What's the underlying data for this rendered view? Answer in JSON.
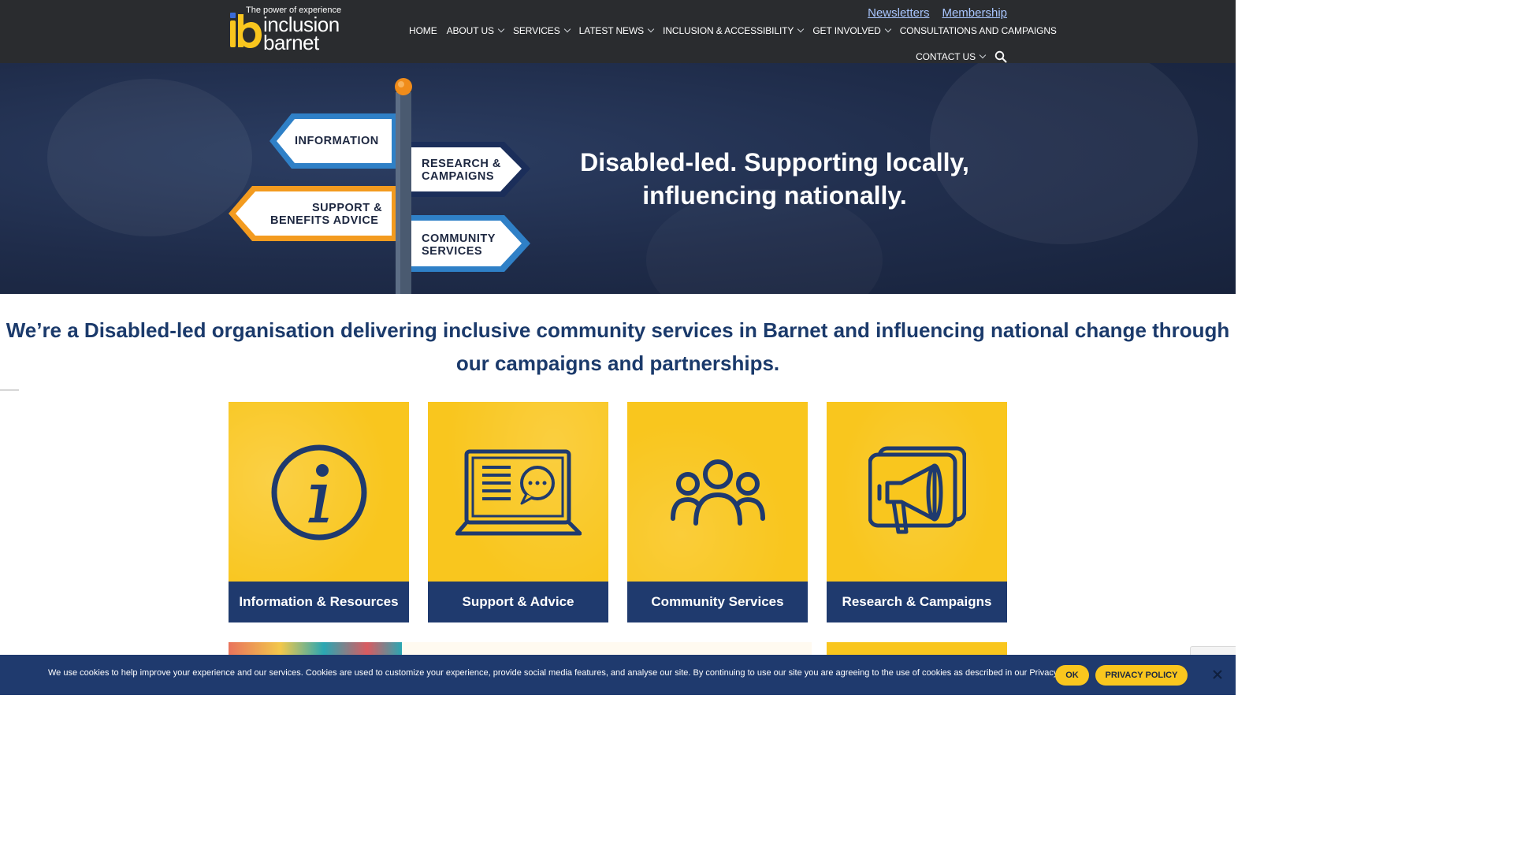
{
  "logo": {
    "tagline": "The power of experience",
    "word1": "inclusion",
    "word2": "barnet"
  },
  "toplinks": [
    {
      "label": "Newsletters"
    },
    {
      "label": "Membership"
    }
  ],
  "nav": {
    "row1": [
      {
        "label": "HOME",
        "dropdown": false
      },
      {
        "label": "ABOUT US",
        "dropdown": true
      },
      {
        "label": "SERVICES",
        "dropdown": true
      },
      {
        "label": "LATEST NEWS",
        "dropdown": true
      },
      {
        "label": "INCLUSION & ACCESSIBILITY",
        "dropdown": true
      },
      {
        "label": "GET INVOLVED",
        "dropdown": true
      },
      {
        "label": "CONSULTATIONS AND CAMPAIGNS",
        "dropdown": false
      }
    ],
    "row2": [
      {
        "label": "CONTACT US",
        "dropdown": true
      }
    ],
    "search_icon": "search-icon"
  },
  "hero": {
    "heading": "Disabled-led. Supporting locally, influencing nationally.",
    "signs": {
      "information": "INFORMATION",
      "research_l1": "RESEARCH &",
      "research_l2": "CAMPAIGNS",
      "support_l1": "SUPPORT &",
      "support_l2": "BENEFITS ADVICE",
      "community_l1": "COMMUNITY",
      "community_l2": "SERVICES"
    }
  },
  "intro": {
    "text": "We’re a Disabled-led organisation delivering inclusive community services in Barnet and influencing national change through our campaigns and partnerships."
  },
  "cards": [
    {
      "label": "Information & Resources",
      "icon": "info-icon"
    },
    {
      "label": "Support & Advice",
      "icon": "laptop-chat-icon"
    },
    {
      "label": "Community Services",
      "icon": "people-group-icon"
    },
    {
      "label": "Research & Campaigns",
      "icon": "megaphone-icon"
    }
  ],
  "cookie": {
    "text": "We use cookies to help improve your experience and our services. Cookies are used to customize your experience, provide social media features, and analyse our site. By continuing to use our site you are agreeing to the use of cookies as described in our Privacy Policy.",
    "ok_label": "OK",
    "policy_label": "PRIVACY POLICY"
  },
  "colors": {
    "header_bg": "#2a2c2f",
    "brand_navy": "#1f3a6e",
    "brand_yellow": "#f9c61e",
    "intro_text": "#1b3a6b",
    "link_blue": "#a9c6ff"
  }
}
